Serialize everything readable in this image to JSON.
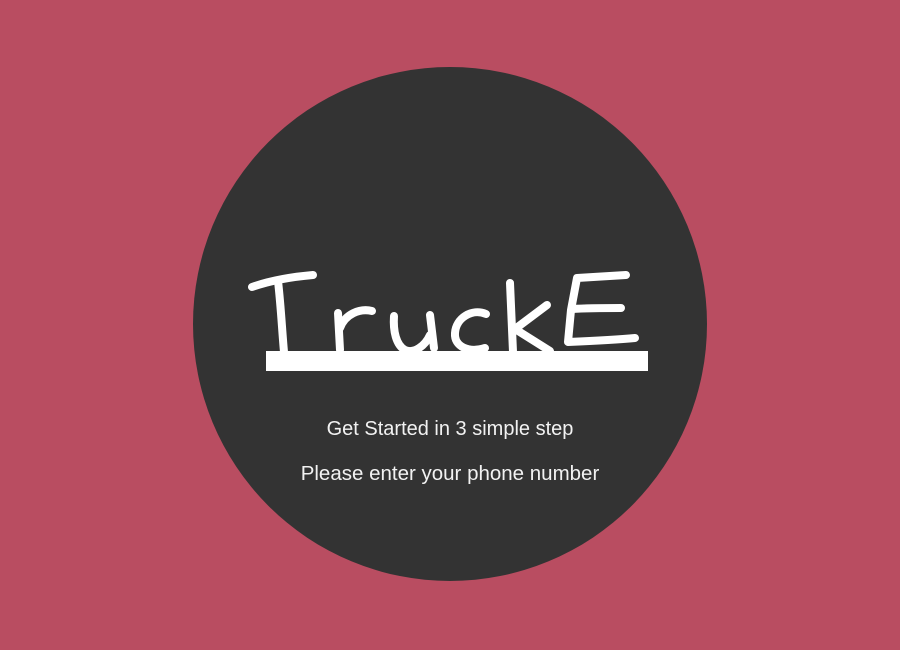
{
  "brand": {
    "logo_text": "Trucke",
    "logo_color": "#ffffff"
  },
  "onboarding": {
    "step_text": "Get Started in 3 simple step",
    "instruction_text": "Please enter your phone number"
  },
  "colors": {
    "background": "#b94d61",
    "circle": "#333333",
    "text": "#f2f2f2"
  }
}
